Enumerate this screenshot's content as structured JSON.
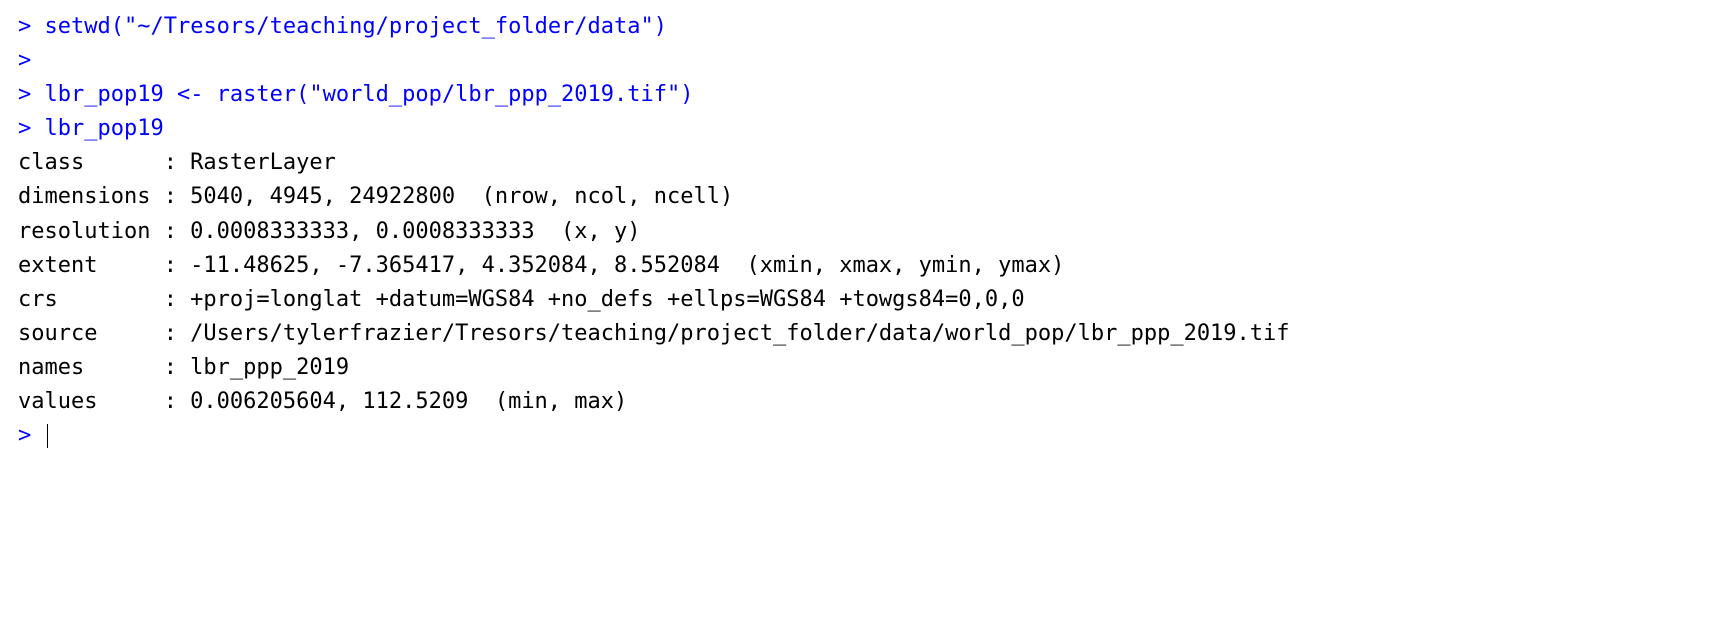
{
  "console": {
    "prompt": "> ",
    "lines": [
      {
        "type": "input",
        "text": "setwd(\"~/Tresors/teaching/project_folder/data\")"
      },
      {
        "type": "input",
        "text": ""
      },
      {
        "type": "input",
        "text": "lbr_pop19 <- raster(\"world_pop/lbr_ppp_2019.tif\")"
      },
      {
        "type": "input",
        "text": "lbr_pop19"
      },
      {
        "type": "output",
        "text": "class      : RasterLayer "
      },
      {
        "type": "output",
        "text": "dimensions : 5040, 4945, 24922800  (nrow, ncol, ncell)"
      },
      {
        "type": "output",
        "text": "resolution : 0.0008333333, 0.0008333333  (x, y)"
      },
      {
        "type": "output",
        "text": "extent     : -11.48625, -7.365417, 4.352084, 8.552084  (xmin, xmax, ymin, ymax)"
      },
      {
        "type": "output",
        "text": "crs        : +proj=longlat +datum=WGS84 +no_defs +ellps=WGS84 +towgs84=0,0,0 "
      },
      {
        "type": "output",
        "text": "source     : /Users/tylerfrazier/Tresors/teaching/project_folder/data/world_pop/lbr_ppp_2019.tif "
      },
      {
        "type": "output",
        "text": "names      : lbr_ppp_2019 "
      },
      {
        "type": "output",
        "text": "values     : 0.006205604, 112.5209  (min, max)"
      },
      {
        "type": "output",
        "text": ""
      },
      {
        "type": "cursor",
        "text": ""
      }
    ]
  }
}
